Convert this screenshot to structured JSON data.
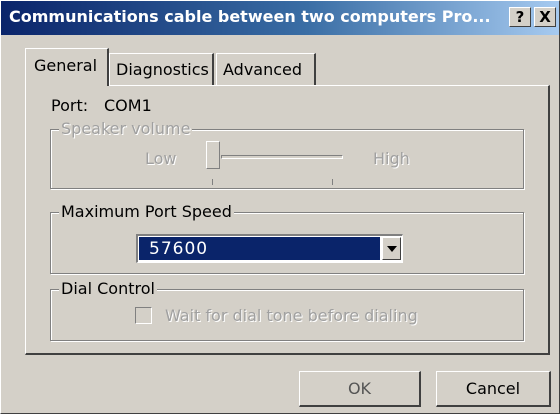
{
  "window": {
    "title": "Communications cable between two computers Pro...",
    "help_label": "?",
    "close_label": "X"
  },
  "tabs": [
    {
      "label": "General",
      "active": true
    },
    {
      "label": "Diagnostics",
      "active": false
    },
    {
      "label": "Advanced",
      "active": false
    }
  ],
  "port": {
    "label": "Port:",
    "value": "COM1"
  },
  "speaker_volume": {
    "group_label": "Speaker volume",
    "low_label": "Low",
    "high_label": "High",
    "level": 0,
    "enabled": false
  },
  "max_port_speed": {
    "group_label": "Maximum Port Speed",
    "selected_value": "57600"
  },
  "dial_control": {
    "group_label": "Dial Control",
    "checkbox_label": "Wait for dial tone before dialing",
    "checked": false,
    "enabled": false
  },
  "buttons": {
    "ok_label": "OK",
    "cancel_label": "Cancel"
  },
  "colors": {
    "titlebar_start": "#0a246a",
    "titlebar_end": "#a6caf0",
    "face": "#d4d0c8",
    "selection": "#0a246a",
    "disabled_text": "#a0a0a0"
  }
}
